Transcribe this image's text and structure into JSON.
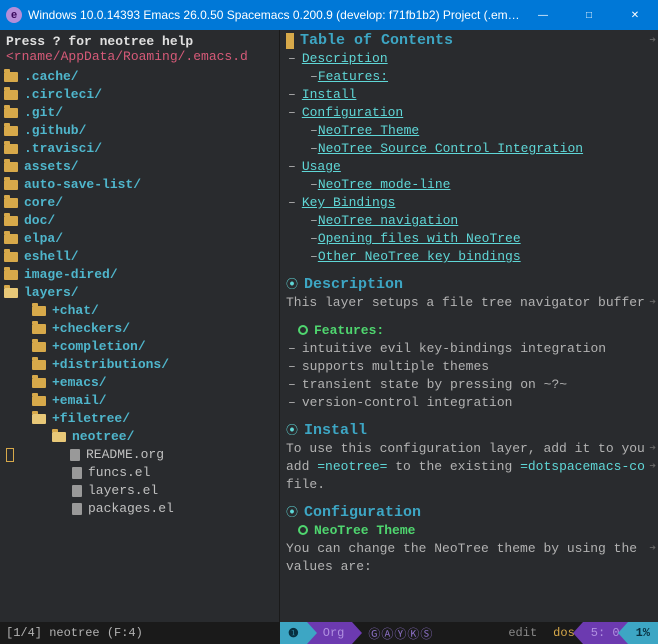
{
  "titlebar": {
    "icon_glyph": "e",
    "text": "Windows 10.0.14393  Emacs 26.0.50  Spacemacs 0.200.9 (develop: f71fb1b2)  Project (.emac…"
  },
  "sidebar": {
    "help": "Press ? for neotree help",
    "path": "<rname/AppData/Roaming/.emacs.d",
    "tree": {
      "folders_top": [
        ".cache/",
        ".circleci/",
        ".git/",
        ".github/",
        ".travisci/",
        "assets/",
        "auto-save-list/",
        "core/",
        "doc/",
        "elpa/",
        "eshell/",
        "image-dired/"
      ],
      "layers_label": "layers/",
      "layer_subfolders": [
        "+chat/",
        "+checkers/",
        "+completion/",
        "+distributions/",
        "+emacs/",
        "+email/",
        "+filetree/"
      ],
      "neotree_label": "neotree/",
      "neotree_files": [
        "README.org",
        "funcs.el",
        "layers.el",
        "packages.el"
      ]
    }
  },
  "content": {
    "toc_title": "Table of Contents",
    "toc": {
      "l1_desc": "Description",
      "l2_features": "Features:",
      "l1_install": "Install",
      "l1_config": "Configuration",
      "l2_theme": "NeoTree Theme",
      "l2_vcs": "NeoTree Source Control Integration",
      "l1_usage": "Usage",
      "l2_modeline": "NeoTree mode-line",
      "l1_keys": "Key Bindings",
      "l2_nav": "NeoTree navigation",
      "l2_open": "Opening files with NeoTree",
      "l2_other": "Other NeoTree key bindings"
    },
    "desc_title": "Description",
    "desc_body": "This layer setups a file tree navigator buffer",
    "features_title": "Features:",
    "features_items": [
      "intuitive evil key-bindings integration",
      "supports multiple themes",
      "transient state by pressing on ~?~",
      "version-control integration"
    ],
    "install_title": "Install",
    "install_line1": "To use this configuration layer, add it to you",
    "install_line2_pre": "add ",
    "install_line2_code1": "=neotree=",
    "install_line2_mid": " to the existing ",
    "install_line2_code2": "=dotspacemacs-co",
    "install_line3": "file.",
    "config_title": "Configuration",
    "theme_title": "NeoTree Theme",
    "theme_body1": "You can change the NeoTree theme by using the ",
    "theme_body2": "values are:"
  },
  "modeline": {
    "left": "[1/4] neotree (F:4)",
    "wnum": "❶",
    "major": "Org",
    "minor_circled": "ⒼⒶⓎⓀⓈ",
    "vcs": "edit",
    "enc": "dos",
    "pos": "5: 0",
    "pct": "1%"
  }
}
